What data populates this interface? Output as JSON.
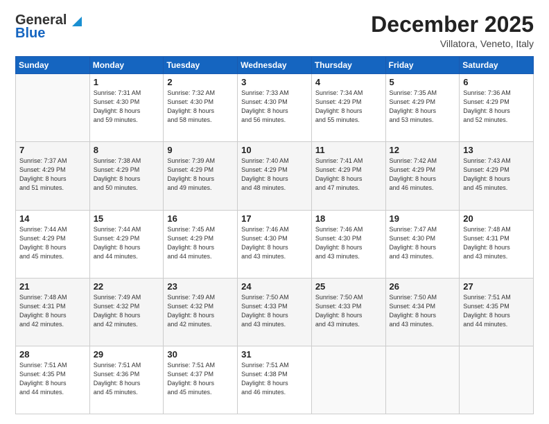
{
  "header": {
    "logo_line1": "General",
    "logo_line2": "Blue",
    "month": "December 2025",
    "location": "Villatora, Veneto, Italy"
  },
  "days_of_week": [
    "Sunday",
    "Monday",
    "Tuesday",
    "Wednesday",
    "Thursday",
    "Friday",
    "Saturday"
  ],
  "weeks": [
    [
      {
        "day": "",
        "info": ""
      },
      {
        "day": "1",
        "info": "Sunrise: 7:31 AM\nSunset: 4:30 PM\nDaylight: 8 hours\nand 59 minutes."
      },
      {
        "day": "2",
        "info": "Sunrise: 7:32 AM\nSunset: 4:30 PM\nDaylight: 8 hours\nand 58 minutes."
      },
      {
        "day": "3",
        "info": "Sunrise: 7:33 AM\nSunset: 4:30 PM\nDaylight: 8 hours\nand 56 minutes."
      },
      {
        "day": "4",
        "info": "Sunrise: 7:34 AM\nSunset: 4:29 PM\nDaylight: 8 hours\nand 55 minutes."
      },
      {
        "day": "5",
        "info": "Sunrise: 7:35 AM\nSunset: 4:29 PM\nDaylight: 8 hours\nand 53 minutes."
      },
      {
        "day": "6",
        "info": "Sunrise: 7:36 AM\nSunset: 4:29 PM\nDaylight: 8 hours\nand 52 minutes."
      }
    ],
    [
      {
        "day": "7",
        "info": "Sunrise: 7:37 AM\nSunset: 4:29 PM\nDaylight: 8 hours\nand 51 minutes."
      },
      {
        "day": "8",
        "info": "Sunrise: 7:38 AM\nSunset: 4:29 PM\nDaylight: 8 hours\nand 50 minutes."
      },
      {
        "day": "9",
        "info": "Sunrise: 7:39 AM\nSunset: 4:29 PM\nDaylight: 8 hours\nand 49 minutes."
      },
      {
        "day": "10",
        "info": "Sunrise: 7:40 AM\nSunset: 4:29 PM\nDaylight: 8 hours\nand 48 minutes."
      },
      {
        "day": "11",
        "info": "Sunrise: 7:41 AM\nSunset: 4:29 PM\nDaylight: 8 hours\nand 47 minutes."
      },
      {
        "day": "12",
        "info": "Sunrise: 7:42 AM\nSunset: 4:29 PM\nDaylight: 8 hours\nand 46 minutes."
      },
      {
        "day": "13",
        "info": "Sunrise: 7:43 AM\nSunset: 4:29 PM\nDaylight: 8 hours\nand 45 minutes."
      }
    ],
    [
      {
        "day": "14",
        "info": "Sunrise: 7:44 AM\nSunset: 4:29 PM\nDaylight: 8 hours\nand 45 minutes."
      },
      {
        "day": "15",
        "info": "Sunrise: 7:44 AM\nSunset: 4:29 PM\nDaylight: 8 hours\nand 44 minutes."
      },
      {
        "day": "16",
        "info": "Sunrise: 7:45 AM\nSunset: 4:29 PM\nDaylight: 8 hours\nand 44 minutes."
      },
      {
        "day": "17",
        "info": "Sunrise: 7:46 AM\nSunset: 4:30 PM\nDaylight: 8 hours\nand 43 minutes."
      },
      {
        "day": "18",
        "info": "Sunrise: 7:46 AM\nSunset: 4:30 PM\nDaylight: 8 hours\nand 43 minutes."
      },
      {
        "day": "19",
        "info": "Sunrise: 7:47 AM\nSunset: 4:30 PM\nDaylight: 8 hours\nand 43 minutes."
      },
      {
        "day": "20",
        "info": "Sunrise: 7:48 AM\nSunset: 4:31 PM\nDaylight: 8 hours\nand 43 minutes."
      }
    ],
    [
      {
        "day": "21",
        "info": "Sunrise: 7:48 AM\nSunset: 4:31 PM\nDaylight: 8 hours\nand 42 minutes."
      },
      {
        "day": "22",
        "info": "Sunrise: 7:49 AM\nSunset: 4:32 PM\nDaylight: 8 hours\nand 42 minutes."
      },
      {
        "day": "23",
        "info": "Sunrise: 7:49 AM\nSunset: 4:32 PM\nDaylight: 8 hours\nand 42 minutes."
      },
      {
        "day": "24",
        "info": "Sunrise: 7:50 AM\nSunset: 4:33 PM\nDaylight: 8 hours\nand 43 minutes."
      },
      {
        "day": "25",
        "info": "Sunrise: 7:50 AM\nSunset: 4:33 PM\nDaylight: 8 hours\nand 43 minutes."
      },
      {
        "day": "26",
        "info": "Sunrise: 7:50 AM\nSunset: 4:34 PM\nDaylight: 8 hours\nand 43 minutes."
      },
      {
        "day": "27",
        "info": "Sunrise: 7:51 AM\nSunset: 4:35 PM\nDaylight: 8 hours\nand 44 minutes."
      }
    ],
    [
      {
        "day": "28",
        "info": "Sunrise: 7:51 AM\nSunset: 4:35 PM\nDaylight: 8 hours\nand 44 minutes."
      },
      {
        "day": "29",
        "info": "Sunrise: 7:51 AM\nSunset: 4:36 PM\nDaylight: 8 hours\nand 45 minutes."
      },
      {
        "day": "30",
        "info": "Sunrise: 7:51 AM\nSunset: 4:37 PM\nDaylight: 8 hours\nand 45 minutes."
      },
      {
        "day": "31",
        "info": "Sunrise: 7:51 AM\nSunset: 4:38 PM\nDaylight: 8 hours\nand 46 minutes."
      },
      {
        "day": "",
        "info": ""
      },
      {
        "day": "",
        "info": ""
      },
      {
        "day": "",
        "info": ""
      }
    ]
  ]
}
